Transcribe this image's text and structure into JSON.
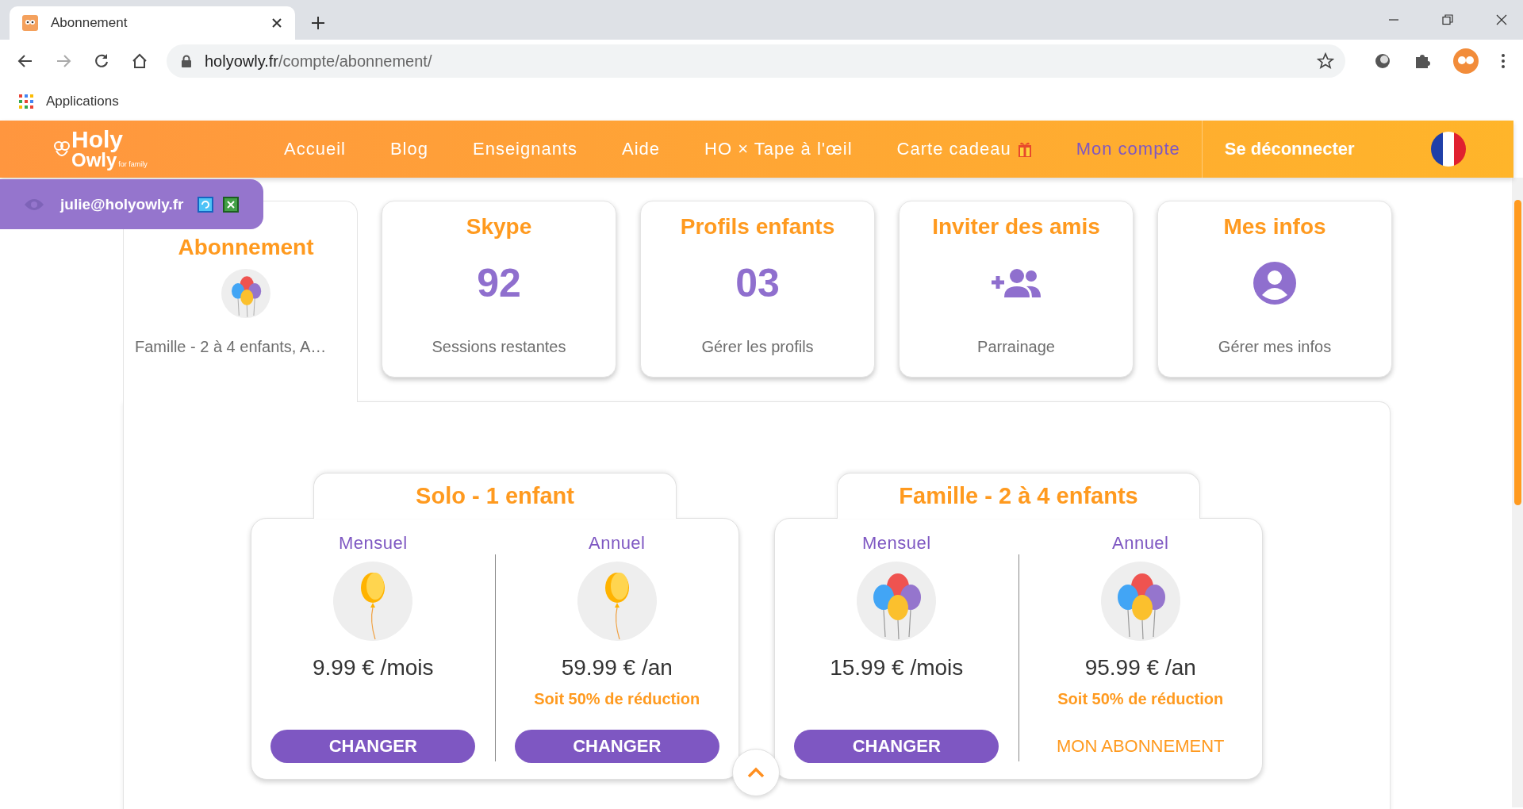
{
  "browser": {
    "tab_title": "Abonnement",
    "url_host": "holyowly.fr",
    "url_path": "/compte/abonnement/",
    "bookmark": "Applications"
  },
  "nav": {
    "logo_top": "Holy",
    "logo_bottom": "Owly",
    "logo_tag": "for family",
    "items": [
      {
        "label": "Accueil",
        "selected": false
      },
      {
        "label": "Blog",
        "selected": false
      },
      {
        "label": "Enseignants",
        "selected": false
      },
      {
        "label": "Aide",
        "selected": false
      },
      {
        "label": "HO × Tape à l'œil",
        "selected": false
      },
      {
        "label": "Carte cadeau",
        "selected": false,
        "kind": "gift"
      },
      {
        "label": "Mon compte",
        "selected": true
      }
    ],
    "logout": "Se déconnecter"
  },
  "impersonation": {
    "email": "julie@holyowly.fr"
  },
  "account_tabs": [
    {
      "title": "Abonnement",
      "kind": "balloons",
      "caption": "Famille - 2 à 4 enfants, A…",
      "selected": true
    },
    {
      "title": "Skype",
      "kind": "number",
      "value": "92",
      "caption": "Sessions restantes",
      "selected": false
    },
    {
      "title": "Profils enfants",
      "kind": "number",
      "value": "03",
      "caption": "Gérer les profils",
      "selected": false
    },
    {
      "title": "Inviter des amis",
      "kind": "add-people",
      "caption": "Parrainage",
      "selected": false
    },
    {
      "title": "Mes infos",
      "kind": "person",
      "caption": "Gérer mes infos",
      "selected": false
    }
  ],
  "plans": [
    {
      "name": "Solo - 1 enfant",
      "options": [
        {
          "period": "Mensuel",
          "kind": "single",
          "price": "9.99 € /mois",
          "action": {
            "label": "CHANGER",
            "kind": "button"
          }
        },
        {
          "period": "Annuel",
          "kind": "single",
          "price": "59.99 € /an",
          "discount": "Soit 50% de réduction",
          "action": {
            "label": "CHANGER",
            "kind": "button"
          }
        }
      ]
    },
    {
      "name": "Famille - 2 à 4 enfants",
      "options": [
        {
          "period": "Mensuel",
          "kind": "bunch",
          "price": "15.99 € /mois",
          "action": {
            "label": "CHANGER",
            "kind": "button"
          }
        },
        {
          "period": "Annuel",
          "kind": "bunch",
          "price": "95.99 € /an",
          "discount": "Soit 50% de réduction",
          "action": {
            "label": "MON ABONNEMENT",
            "kind": "current"
          }
        }
      ]
    }
  ]
}
